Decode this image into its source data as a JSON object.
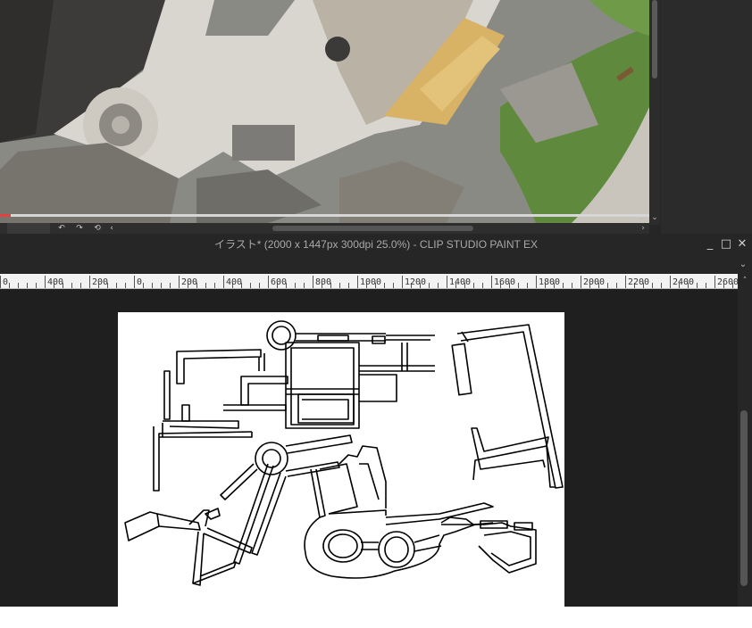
{
  "reference_window": {
    "photo_name": "aerial-castle-reference-photo",
    "scroll_down_glyph": "⌄",
    "scroll_right_glyph": "›",
    "corner_glyph": "⌃",
    "controls": [
      {
        "name": "undo-icon",
        "glyph": "↶"
      },
      {
        "name": "redo-icon",
        "glyph": "↷"
      },
      {
        "name": "rotate-reset-icon",
        "glyph": "⟲"
      },
      {
        "name": "scroll-left-icon",
        "glyph": "‹"
      }
    ]
  },
  "main_window": {
    "title": "イラスト* (2000 x 1447px 300dpi 25.0%)  - CLIP STUDIO PAINT EX",
    "minimize_glyph": "_",
    "maximize_glyph": "□",
    "close_glyph": "✕",
    "collapse_glyph": "⌄",
    "ruler_up_glyph": "˄",
    "ruler_labels": [
      "0",
      "400",
      "200",
      "0",
      "200",
      "400",
      "600",
      "800",
      "1000",
      "1200",
      "1400",
      "1600",
      "1800",
      "2000",
      "2200",
      "2400",
      "2600"
    ]
  },
  "colors": {
    "chrome_dark": "#262626",
    "canvas_bg": "#1f1f1f",
    "paper": "#ffffff",
    "progress_accent": "#e34040"
  }
}
